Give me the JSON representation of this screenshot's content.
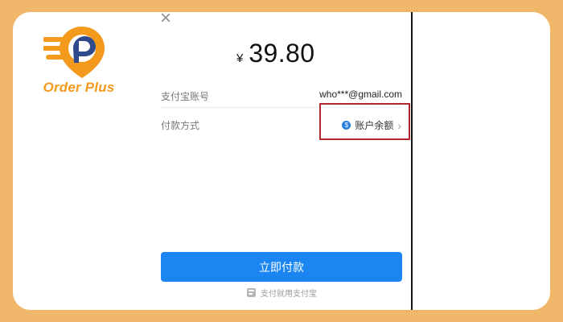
{
  "brand": {
    "name": "Order Plus"
  },
  "payment": {
    "currency_symbol": "¥",
    "amount": "39.80",
    "account_label": "支付宝账号",
    "account_value": "who***@gmail.com",
    "method_label": "付款方式",
    "method_value": "账户余额"
  },
  "actions": {
    "pay_now": "立即付款"
  },
  "footer": {
    "note": "支付就用支付宝"
  },
  "colors": {
    "background": "#f0b76a",
    "card": "#ffffff",
    "primary_button": "#1b86f2",
    "highlight_border": "#b3262d",
    "logo_orange": "#f39a1d",
    "logo_blue": "#2e4a8c"
  },
  "icons": {
    "close": "close-icon",
    "balance": "balance-icon",
    "chevron": "chevron-right-icon",
    "footer": "alipay-icon",
    "logo": "order-plus-logo"
  }
}
